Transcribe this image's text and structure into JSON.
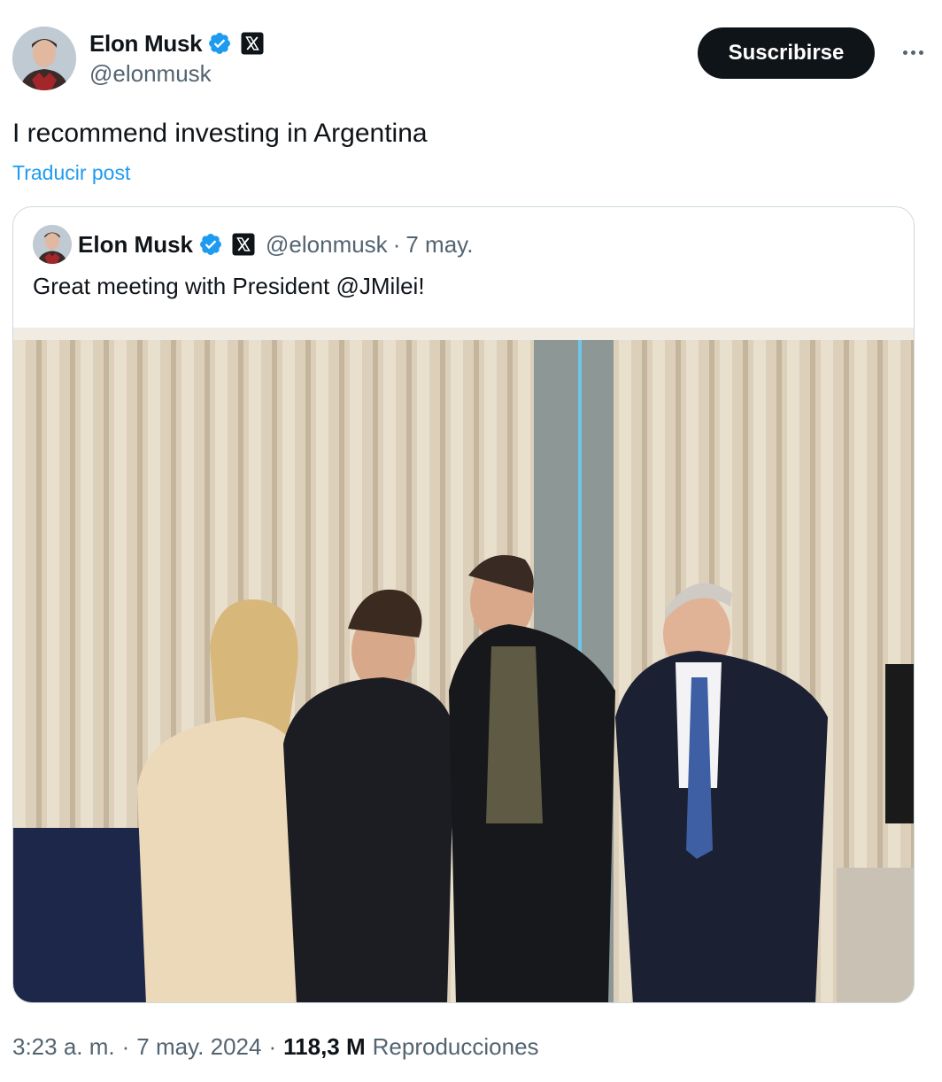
{
  "author": {
    "display_name": "Elon Musk",
    "handle": "@elonmusk",
    "verified_icon": "verified-badge-icon",
    "affiliation_icon": "x-logo-icon"
  },
  "actions": {
    "subscribe_label": "Suscribirse",
    "more_icon": "more-options-icon"
  },
  "post": {
    "text": "I recommend investing in Argentina",
    "translate_label": "Traducir post"
  },
  "quoted_post": {
    "display_name": "Elon Musk",
    "handle": "@elonmusk",
    "separator": "·",
    "date": "7 may.",
    "text": "Great meeting with President @JMilei!",
    "image_description_icon": "photo-icon"
  },
  "footer": {
    "time": "3:23 a. m.",
    "separator": "·",
    "date": "7 may. 2024",
    "views_count": "118,3 M",
    "views_label": "Reproducciones"
  },
  "colors": {
    "text_primary": "#0f1419",
    "text_secondary": "#536471",
    "link": "#1d9bf0",
    "verified": "#1d9bf0",
    "border": "#cfd9de"
  }
}
